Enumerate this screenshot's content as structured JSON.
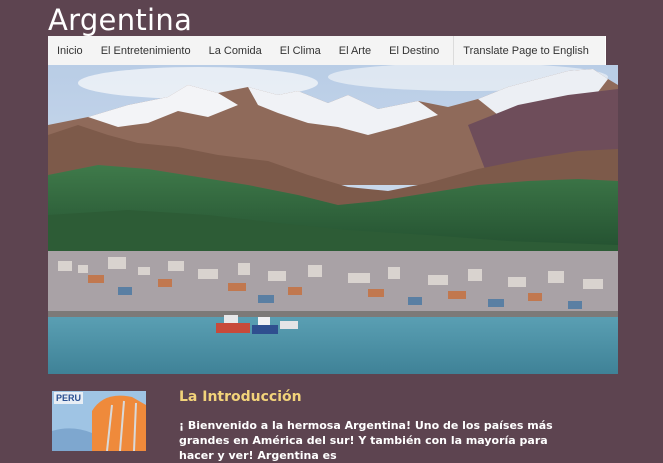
{
  "site": {
    "title": "Argentina"
  },
  "nav": {
    "items": [
      {
        "label": "Inicio"
      },
      {
        "label": "El Entretenimiento"
      },
      {
        "label": "La Comida"
      },
      {
        "label": "El Clima"
      },
      {
        "label": "El Arte"
      },
      {
        "label": "El Destino"
      }
    ],
    "translate_label": "Translate Page to English"
  },
  "hero": {
    "image": "mountain-harbor-city-photo"
  },
  "intro": {
    "heading": "La Introducción",
    "thumb_label": "PERU",
    "text": "¡ Bienvenido a la hermosa Argentina! Uno de los países más grandes en América del sur! Y también con la mayoría para hacer y ver! Argentina es"
  },
  "colors": {
    "background": "#5d4450",
    "heading": "#f2d37a",
    "nav_bg": "#f4f4f4"
  }
}
